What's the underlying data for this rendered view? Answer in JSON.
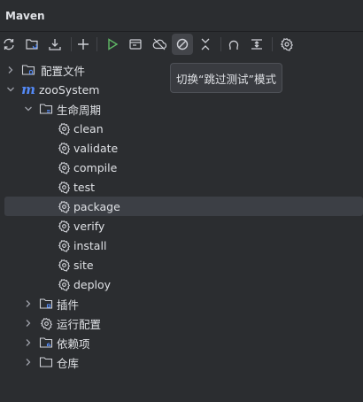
{
  "panel": {
    "title": "Maven"
  },
  "toolbar": {
    "buttons": [
      {
        "name": "reload-icon"
      },
      {
        "name": "generate-sources-icon"
      },
      {
        "name": "download-icon"
      },
      {
        "name": "add-icon"
      },
      {
        "name": "run-icon"
      },
      {
        "name": "execute-goal-icon"
      },
      {
        "name": "offline-mode-icon"
      },
      {
        "name": "skip-tests-icon"
      },
      {
        "name": "collapse-all-icon"
      },
      {
        "name": "dependency-analyzer-icon"
      },
      {
        "name": "show-diagram-icon"
      },
      {
        "name": "settings-icon"
      }
    ]
  },
  "tooltip": {
    "text": "切换“跳过测试”模式"
  },
  "tree": {
    "config_files": "配置文件",
    "project": "zooSystem",
    "lifecycle": "生命周期",
    "goals": [
      "clean",
      "validate",
      "compile",
      "test",
      "package",
      "verify",
      "install",
      "site",
      "deploy"
    ],
    "plugins": "插件",
    "run_configs": "运行配置",
    "dependencies": "依赖项",
    "repositories": "仓库"
  },
  "colors": {
    "background": "#2b2d30",
    "selection": "#3c3f45",
    "maven_blue": "#548af7",
    "run_green": "#5fb865"
  }
}
